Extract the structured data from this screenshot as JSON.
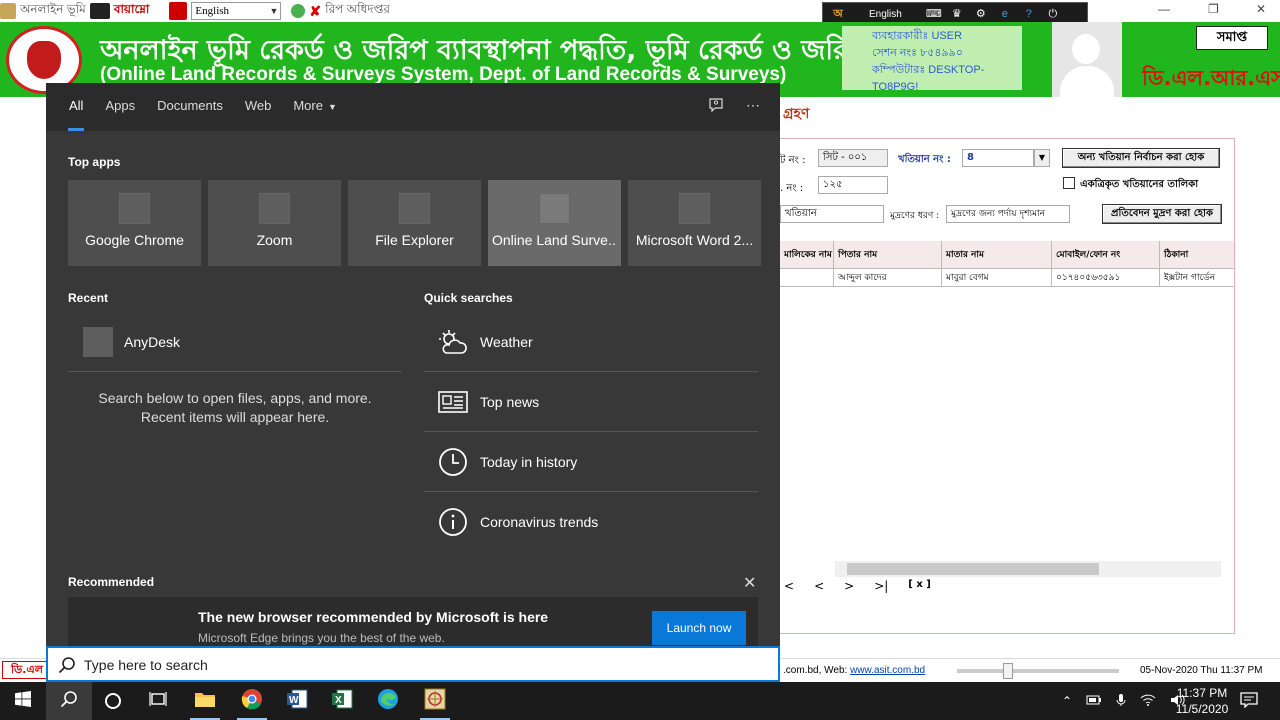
{
  "app": {
    "titlebar_text": "অনলাইন ভূমি",
    "bijoy_label": "বায়াম্নো",
    "lang_select": "English",
    "titlebar_suffix": "রিপ অধিদপ্তর",
    "toolbar_lang": "English",
    "banner_title_bn": "অনলাইন ভূমি রেকর্ড ও জরিপ ব্যাবস্থাপনা পদ্ধতি, ভূমি রেকর্ড ও জরিপ অধিদপ্তর",
    "banner_title_en": "(Online Land Records & Surveys System, Dept. of Land Records & Surveys)",
    "user_line": "ব্যবহারকারীঃ USER",
    "session_line": "সেশন নংঃ ৮৫৪৯৯০",
    "computer_line": "কম্পিউটারঃ DESKTOP-TO8P9G!",
    "close_label": "সমাপ্ত",
    "dlrs_label": "ডি.এল.আর.এস",
    "section_title": "গ্রহণ",
    "sheet_label": "ট নং :",
    "sheet_value": "সিট - ০০১",
    "khatian_label": "খতিয়ান নং :",
    "khatian_value": "8",
    "other_khatian_btn": "অন্য খতিয়ান নির্বাচন করা হোক",
    "dag_label": ". নং :",
    "dag_value": "১২৫",
    "integrated_label": "একত্রিকৃত খতিয়ানের তালিকা",
    "khatian_type": "খতিয়ান",
    "print_type_label": "মুদ্রণের ধরণ :",
    "print_type_value": "মুদ্রণের জন্য পর্দায় দৃশ্যমান",
    "report_print_btn": "প্রতিবেদন মুদ্রণ করা হোক",
    "grid_headers": [
      "মালিকের নাম",
      "পিতার নাম",
      "মাতার নাম",
      "মোবাইল/ফোন নং",
      "ঠিকানা"
    ],
    "grid_row": [
      "",
      "আব্দুল কাদের",
      "মাবুরা বেগম",
      "০১৭৪০৫৬৩৫৯১",
      "ইক্সটান গার্ডেন"
    ],
    "pager": [
      "<",
      "<",
      ">",
      ">|",
      "[ x ]"
    ],
    "status_left": "ডি.এল",
    "status_web_prefix": ".com.bd, Web: ",
    "status_web_link": "www.asit.com.bd",
    "status_datetime": "05-Nov-2020 Thu 11:37 PM"
  },
  "start_menu": {
    "tabs": [
      {
        "label": "All",
        "active": true
      },
      {
        "label": "Apps"
      },
      {
        "label": "Documents"
      },
      {
        "label": "Web"
      },
      {
        "label": "More"
      }
    ],
    "top_apps_heading": "Top apps",
    "top_apps": [
      "Google Chrome",
      "Zoom",
      "File Explorer",
      "Online Land Surve...",
      "Microsoft Word 2..."
    ],
    "recent_heading": "Recent",
    "recent_items": [
      "AnyDesk"
    ],
    "recent_hint_line1": "Search below to open files, apps, and more.",
    "recent_hint_line2": "Recent items will appear here.",
    "quick_heading": "Quick searches",
    "quick_searches": [
      {
        "label": "Weather",
        "icon": "weather-icon"
      },
      {
        "label": "Top news",
        "icon": "news-icon"
      },
      {
        "label": "Today in history",
        "icon": "clock-icon"
      },
      {
        "label": "Coronavirus trends",
        "icon": "info-icon"
      }
    ],
    "recommended_heading": "Recommended",
    "rec_title": "The new browser recommended by Microsoft is here",
    "rec_subtitle": "Microsoft Edge brings you the best of the web.",
    "launch_label": "Launch now"
  },
  "search": {
    "placeholder": "Type here to search"
  },
  "taskbar": {
    "clock_time": "11:37 PM",
    "clock_date": "11/5/2020"
  },
  "colors": {
    "accent": "#0a78d7",
    "banner_green": "#21b51e"
  }
}
